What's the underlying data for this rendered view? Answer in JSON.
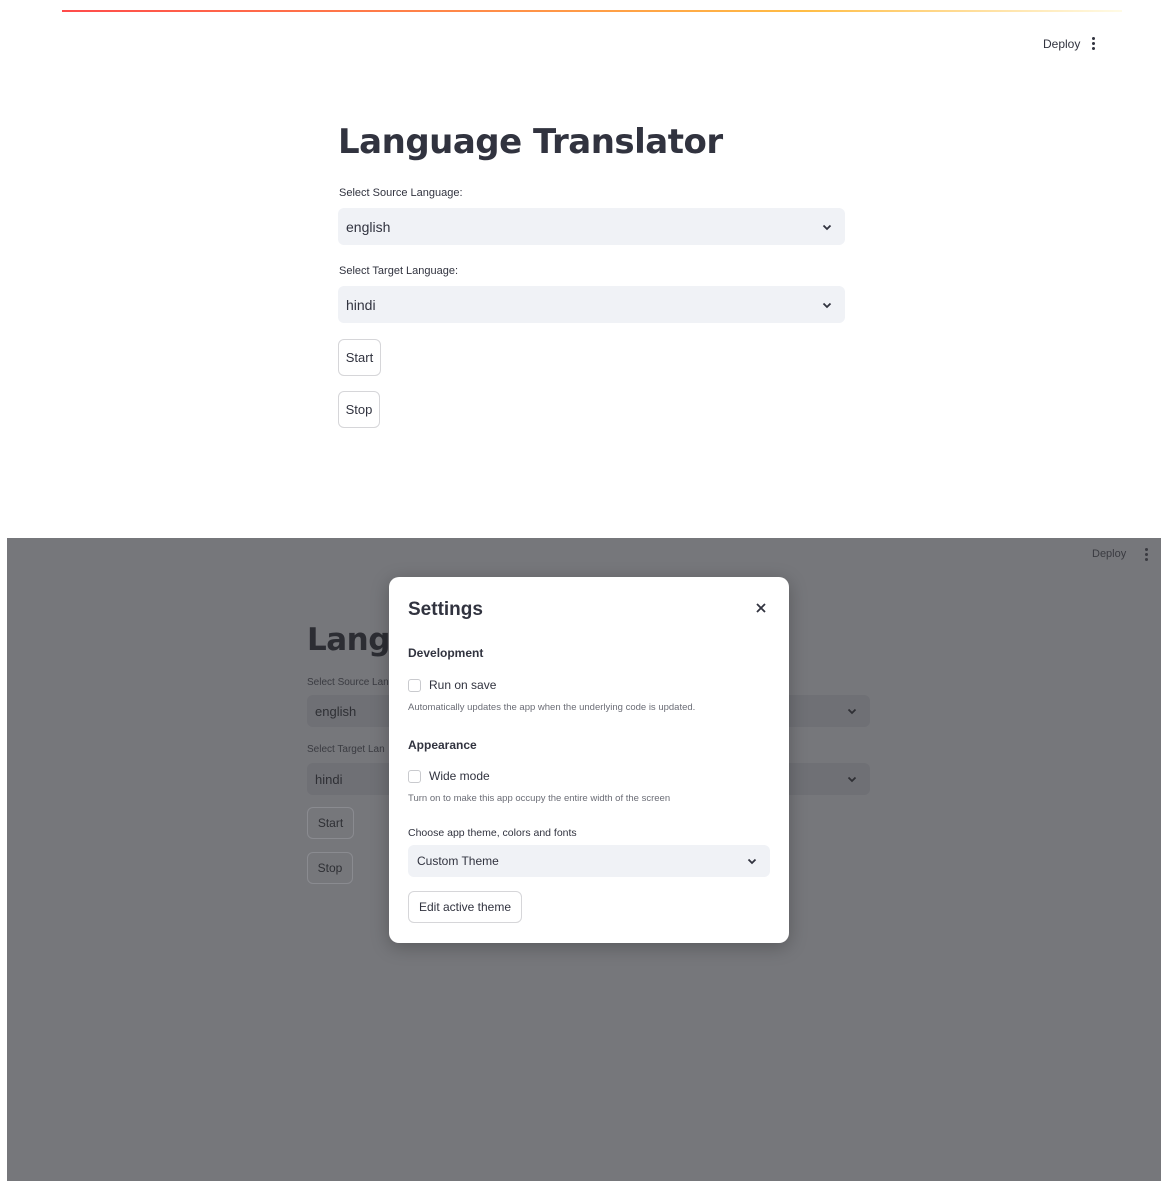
{
  "header": {
    "deploy_label": "Deploy"
  },
  "app": {
    "title": "Language Translator",
    "source": {
      "label": "Select Source Language:",
      "value": "english"
    },
    "target": {
      "label": "Select Target Language:",
      "value": "hindi"
    },
    "start_label": "Start",
    "stop_label": "Stop"
  },
  "background_app": {
    "title_visible": "Langu",
    "source_label_visible": "Select Source Lan",
    "target_label_visible": "Select Target Lan"
  },
  "settings": {
    "title": "Settings",
    "development": {
      "heading": "Development",
      "run_on_save_label": "Run on save",
      "run_on_save_help": "Automatically updates the app when the underlying code is updated."
    },
    "appearance": {
      "heading": "Appearance",
      "wide_mode_label": "Wide mode",
      "wide_mode_help": "Turn on to make this app occupy the entire width of the screen"
    },
    "theme": {
      "label": "Choose app theme, colors and fonts",
      "value": "Custom Theme",
      "edit_button": "Edit active theme"
    }
  },
  "colors": {
    "accent_start": "#ff4b4b",
    "accent_end": "#ffbd45",
    "overlay": "#76777b"
  }
}
